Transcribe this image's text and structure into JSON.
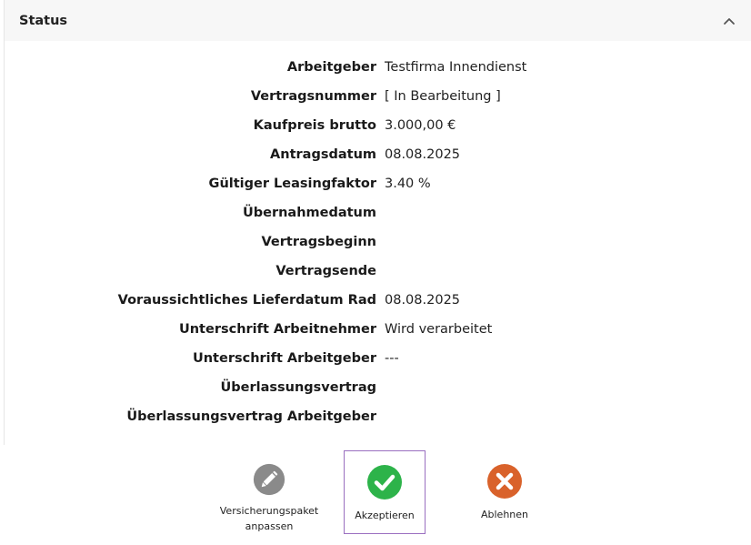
{
  "panel": {
    "title": "Status",
    "collapse_icon": "chevron-up-icon"
  },
  "rows": [
    {
      "label": "Arbeitgeber",
      "value": "Testfirma Innendienst"
    },
    {
      "label": "Vertragsnummer",
      "value": "[ In Bearbeitung ]"
    },
    {
      "label": "Kaufpreis brutto",
      "value": "3.000,00 €"
    },
    {
      "label": "Antragsdatum",
      "value": "08.08.2025"
    },
    {
      "label": "Gültiger Leasingfaktor",
      "value": "3.40 %"
    },
    {
      "label": "Übernahmedatum",
      "value": ""
    },
    {
      "label": "Vertragsbeginn",
      "value": ""
    },
    {
      "label": "Vertragsende",
      "value": ""
    },
    {
      "label": "Voraussichtliches Lieferdatum Rad",
      "value": "08.08.2025"
    },
    {
      "label": "Unterschrift Arbeitnehmer",
      "value": "Wird verarbeitet"
    },
    {
      "label": "Unterschrift Arbeitgeber",
      "value": "---"
    },
    {
      "label": "Überlassungsvertrag",
      "value": ""
    },
    {
      "label": "Überlassungsvertrag Arbeitgeber",
      "value": ""
    }
  ],
  "actions": {
    "edit": {
      "line1": "Versicherungspaket",
      "line2": "anpassen",
      "icon": "pencil-icon",
      "color": "#8a8a8a"
    },
    "accept": {
      "label": "Akzeptieren",
      "icon": "check-icon",
      "color": "#2db34a"
    },
    "reject": {
      "label": "Ablehnen",
      "icon": "x-icon",
      "color": "#d9622b"
    }
  }
}
